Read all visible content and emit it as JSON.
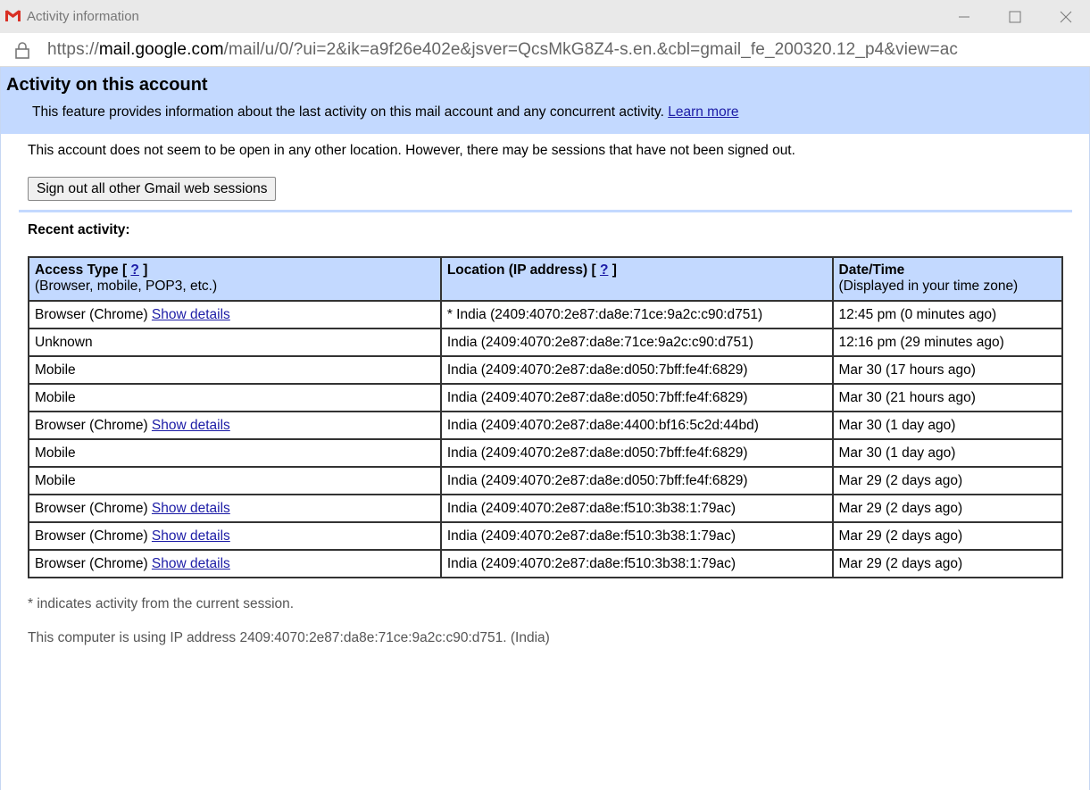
{
  "window": {
    "title": "Activity information",
    "icon": "gmail-icon",
    "controls": [
      "minimize-icon",
      "maximize-icon",
      "close-icon"
    ]
  },
  "address_bar": {
    "icon": "lock-icon",
    "url_prefix": "https://",
    "url_host": "mail.google.com",
    "url_path": "/mail/u/0/?ui=2&ik=a9f26e402e&jsver=QcsMkG8Z4-s.en.&cbl=gmail_fe_200320.12_p4&view=ac"
  },
  "header": {
    "title": "Activity on this account",
    "description": "This feature provides information about the last activity on this mail account and any concurrent activity.",
    "learn_more": "Learn more"
  },
  "notice": "This account does not seem to be open in any other location. However, there may be sessions that have not been signed out.",
  "signout_button": "Sign out all other Gmail web sessions",
  "recent_label": "Recent activity:",
  "table": {
    "headers": [
      {
        "title": "Access Type",
        "help": "?",
        "subtitle": "(Browser, mobile, POP3, etc.)"
      },
      {
        "title": "Location (IP address)",
        "help": "?",
        "subtitle": ""
      },
      {
        "title": "Date/Time",
        "help": "",
        "subtitle": "(Displayed in your time zone)"
      }
    ],
    "rows": [
      {
        "access": "Browser (Chrome)",
        "details": "Show details",
        "location": "* India (2409:4070:2e87:da8e:71ce:9a2c:c90:d751)",
        "time": "12:45 pm (0 minutes ago)"
      },
      {
        "access": "Unknown",
        "details": "",
        "location": "India (2409:4070:2e87:da8e:71ce:9a2c:c90:d751)",
        "time": "12:16 pm (29 minutes ago)"
      },
      {
        "access": "Mobile",
        "details": "",
        "location": "India (2409:4070:2e87:da8e:d050:7bff:fe4f:6829)",
        "time": "Mar 30 (17 hours ago)"
      },
      {
        "access": "Mobile",
        "details": "",
        "location": "India (2409:4070:2e87:da8e:d050:7bff:fe4f:6829)",
        "time": "Mar 30 (21 hours ago)"
      },
      {
        "access": "Browser (Chrome)",
        "details": "Show details",
        "location": "India (2409:4070:2e87:da8e:4400:bf16:5c2d:44bd)",
        "time": "Mar 30 (1 day ago)"
      },
      {
        "access": "Mobile",
        "details": "",
        "location": "India (2409:4070:2e87:da8e:d050:7bff:fe4f:6829)",
        "time": "Mar 30 (1 day ago)"
      },
      {
        "access": "Mobile",
        "details": "",
        "location": "India (2409:4070:2e87:da8e:d050:7bff:fe4f:6829)",
        "time": "Mar 29 (2 days ago)"
      },
      {
        "access": "Browser (Chrome)",
        "details": "Show details",
        "location": "India (2409:4070:2e87:da8e:f510:3b38:1:79ac)",
        "time": "Mar 29 (2 days ago)"
      },
      {
        "access": "Browser (Chrome)",
        "details": "Show details",
        "location": "India (2409:4070:2e87:da8e:f510:3b38:1:79ac)",
        "time": "Mar 29 (2 days ago)"
      },
      {
        "access": "Browser (Chrome)",
        "details": "Show details",
        "location": "India (2409:4070:2e87:da8e:f510:3b38:1:79ac)",
        "time": "Mar 29 (2 days ago)"
      }
    ]
  },
  "footnote": "* indicates activity from the current session.",
  "ip_note": "This computer is using IP address 2409:4070:2e87:da8e:71ce:9a2c:c90:d751. (India)",
  "colors": {
    "header_bg": "#c3d9ff",
    "link": "#1c1ca6",
    "titlebar_bg": "#e9e9e9",
    "gmail_red": "#d93025"
  }
}
